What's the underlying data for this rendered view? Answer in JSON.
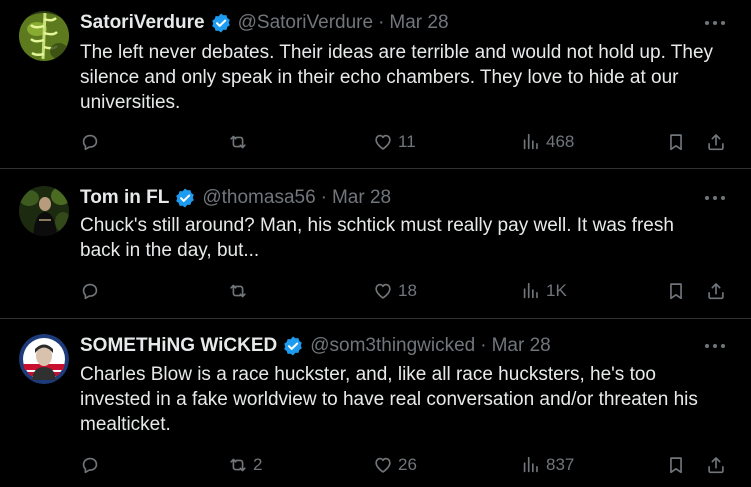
{
  "colors": {
    "background": "#000000",
    "text": "#e7e9ea",
    "muted": "#71767b",
    "verified": "#1d9bf0",
    "divider": "#2f3336"
  },
  "icons": {
    "reply": "reply-icon",
    "repost": "repost-icon",
    "like": "like-icon",
    "views": "views-icon",
    "bookmark": "bookmark-icon",
    "share": "share-icon",
    "more": "more-icon",
    "verified": "verified-badge-icon"
  },
  "tweets": [
    {
      "name": "SatoriVerdure",
      "handle": "@SatoriVerdure",
      "separator": "·",
      "date": "Mar 28",
      "lines": [
        "The left never debates. Their ideas are terrible and would not hold up.  They",
        "silence and only speak in their echo chambers.  They love to hide at our",
        "universities."
      ],
      "replies": "",
      "reposts": "",
      "likes": "11",
      "views": "468"
    },
    {
      "name": "Tom in FL",
      "handle": "@thomasa56",
      "separator": "·",
      "date": "Mar 28",
      "lines": [
        "Chuck's still around? Man, his schtick must really pay well. It was fresh",
        "back in the day, but..."
      ],
      "replies": "",
      "reposts": "",
      "likes": "18",
      "views": "1K"
    },
    {
      "name": "SOMETHiNG WiCKED",
      "handle": "@som3thingwicked",
      "separator": "·",
      "date": "Mar 28",
      "lines": [
        "Charles Blow is a race huckster, and, like all race hucksters, he's too",
        "invested in a fake worldview to have real conversation and/or threaten his",
        "mealticket."
      ],
      "replies": "",
      "reposts": "2",
      "likes": "26",
      "views": "837"
    }
  ]
}
